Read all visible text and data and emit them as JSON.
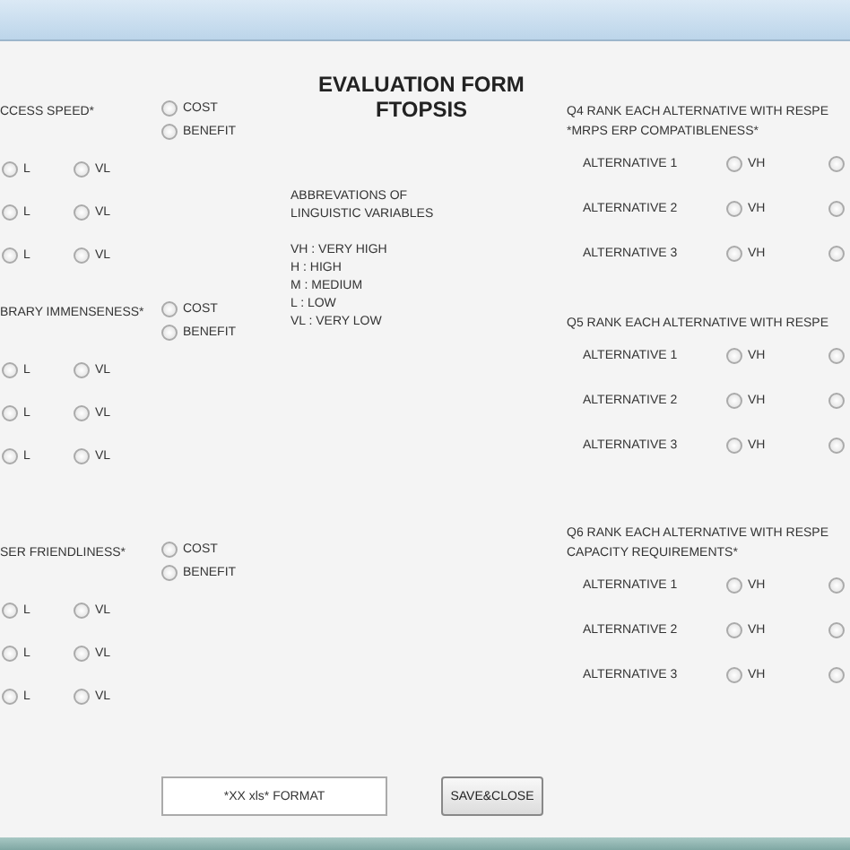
{
  "heading": [
    "EVALUATION FORM",
    "FTOPSIS"
  ],
  "left_questions": [
    {
      "text": "CCESS SPEED*",
      "criterion": [
        {
          "label": "COST",
          "selected": false
        },
        {
          "label": "BENEFIT",
          "selected": false
        }
      ],
      "rows": [
        {
          "options": [
            {
              "label": "L",
              "selected": false
            },
            {
              "label": "VL",
              "selected": false
            }
          ]
        },
        {
          "options": [
            {
              "label": "L",
              "selected": false
            },
            {
              "label": "VL",
              "selected": false
            }
          ]
        },
        {
          "options": [
            {
              "label": "L",
              "selected": false
            },
            {
              "label": "VL",
              "selected": false
            }
          ]
        }
      ]
    },
    {
      "text": "BRARY IMMENSENESS*",
      "criterion": [
        {
          "label": "COST",
          "selected": false
        },
        {
          "label": "BENEFIT",
          "selected": false
        }
      ],
      "rows": [
        {
          "options": [
            {
              "label": "L",
              "selected": false
            },
            {
              "label": "VL",
              "selected": false
            }
          ]
        },
        {
          "options": [
            {
              "label": "L",
              "selected": false
            },
            {
              "label": "VL",
              "selected": false
            }
          ]
        },
        {
          "options": [
            {
              "label": "L",
              "selected": false
            },
            {
              "label": "VL",
              "selected": false
            }
          ]
        }
      ]
    },
    {
      "text": "SER FRIENDLINESS*",
      "criterion": [
        {
          "label": "COST",
          "selected": false
        },
        {
          "label": "BENEFIT",
          "selected": false
        }
      ],
      "rows": [
        {
          "options": [
            {
              "label": "L",
              "selected": false
            },
            {
              "label": "VL",
              "selected": false
            }
          ]
        },
        {
          "options": [
            {
              "label": "L",
              "selected": false
            },
            {
              "label": "VL",
              "selected": false
            }
          ]
        },
        {
          "options": [
            {
              "label": "L",
              "selected": false
            },
            {
              "label": "VL",
              "selected": false
            }
          ]
        }
      ]
    }
  ],
  "abbreviations": {
    "title": [
      "ABBREVATIONS OF",
      "LINGUISTIC VARIABLES"
    ],
    "items": [
      "VH : VERY HIGH",
      "H : HIGH",
      "M : MEDIUM",
      "L : LOW",
      "VL : VERY LOW"
    ]
  },
  "right_questions": [
    {
      "text": [
        "Q4 RANK EACH ALTERNATIVE WITH RESPE",
        "*MRPS ERP COMPATIBLENESS*"
      ],
      "alternatives": [
        {
          "label": "ALTERNATIVE 1",
          "options": [
            {
              "label": "VH",
              "selected": false
            },
            {
              "selected": false
            }
          ]
        },
        {
          "label": "ALTERNATIVE 2",
          "options": [
            {
              "label": "VH",
              "selected": false
            },
            {
              "selected": false
            }
          ]
        },
        {
          "label": "ALTERNATIVE 3",
          "options": [
            {
              "label": "VH",
              "selected": false
            },
            {
              "selected": false
            }
          ]
        }
      ]
    },
    {
      "text": [
        "Q5 RANK EACH ALTERNATIVE WITH RESPE"
      ],
      "alternatives": [
        {
          "label": "ALTERNATIVE 1",
          "options": [
            {
              "label": "VH",
              "selected": false
            },
            {
              "selected": false
            }
          ]
        },
        {
          "label": "ALTERNATIVE 2",
          "options": [
            {
              "label": "VH",
              "selected": false
            },
            {
              "selected": false
            }
          ]
        },
        {
          "label": "ALTERNATIVE 3",
          "options": [
            {
              "label": "VH",
              "selected": false
            },
            {
              "selected": false
            }
          ]
        }
      ]
    },
    {
      "text": [
        "Q6 RANK EACH ALTERNATIVE WITH RESPE",
        "CAPACITY REQUIREMENTS*"
      ],
      "alternatives": [
        {
          "label": "ALTERNATIVE 1",
          "options": [
            {
              "label": "VH",
              "selected": false
            },
            {
              "selected": false
            }
          ]
        },
        {
          "label": "ALTERNATIVE 2",
          "options": [
            {
              "label": "VH",
              "selected": false
            },
            {
              "selected": false
            }
          ]
        },
        {
          "label": "ALTERNATIVE 3",
          "options": [
            {
              "label": "VH",
              "selected": false
            },
            {
              "selected": false
            }
          ]
        }
      ]
    }
  ],
  "format_field": {
    "value": "*XX xls* FORMAT"
  },
  "save_button": "SAVE&CLOSE"
}
